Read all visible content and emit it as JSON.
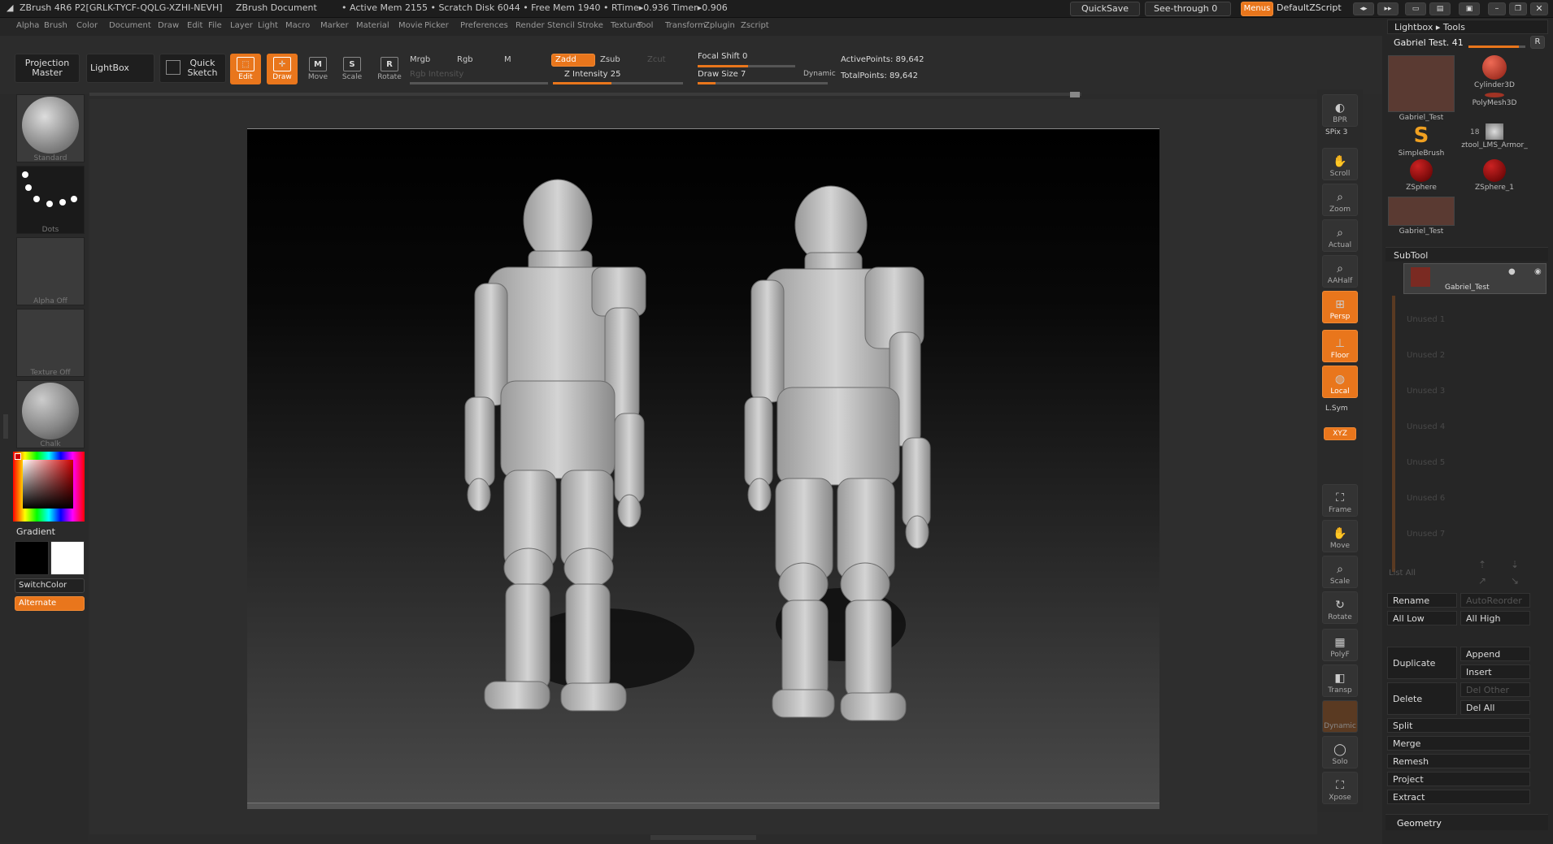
{
  "title": {
    "app": "ZBrush 4R6 P2[GRLK-TYCF-QQLG-XZHI-NEVH]",
    "doc": "ZBrush Document",
    "mem": "• Active Mem 2155 • Scratch Disk 6044 • Free Mem 1940 • RTime▸0.936 Timer▸0.906",
    "quicksave": "QuickSave",
    "seethrough": "See-through  0",
    "menus": "Menus",
    "script": "DefaultZScript"
  },
  "menu": [
    "Alpha",
    "Brush",
    "Color",
    "Document",
    "Draw",
    "Edit",
    "File",
    "Layer",
    "Light",
    "Macro",
    "Marker",
    "Material",
    "Movie",
    "Picker",
    "Preferences",
    "Render",
    "Stencil",
    "Stroke",
    "Texture",
    "Tool",
    "Transform",
    "Zplugin",
    "Zscript"
  ],
  "toolbar": {
    "projection": "Projection Master",
    "lightbox": "LightBox",
    "quicksketch": "Quick Sketch",
    "edit": "Edit",
    "draw": "Draw",
    "move": "Move",
    "scale": "Scale",
    "rotate": "Rotate",
    "mrgb": "Mrgb",
    "rgb": "Rgb",
    "m": "M",
    "zadd": "Zadd",
    "zsub": "Zsub",
    "zcut": "Zcut",
    "rgb_intensity": "Rgb Intensity",
    "z_intensity": "Z Intensity 25",
    "focal": "Focal Shift 0",
    "draw_size": "Draw Size 7",
    "dynamic": "Dynamic",
    "active_points": "ActivePoints: 89,642",
    "total_points": "TotalPoints: 89,642"
  },
  "left": {
    "brush": "Standard",
    "stroke": "Dots",
    "alpha": "Alpha Off",
    "texture": "Texture Off",
    "material": "Chalk",
    "gradient": "Gradient",
    "switchcolor": "SwitchColor",
    "alternate": "Alternate"
  },
  "shelf": [
    "BPR",
    "SPix 3",
    "Scroll",
    "Zoom",
    "Actual",
    "AAHalf",
    "Persp",
    "Floor",
    "Local",
    "L.Sym",
    "XYZ",
    "Frame",
    "Move",
    "Scale",
    "Rotate",
    "PolyF",
    "Transp",
    "Dynamic",
    "Solo",
    "Xpose"
  ],
  "tray": {
    "header": "Lightbox ▸ Tools",
    "tool_name": "Gabriel Test. 41",
    "r": "R",
    "tools": [
      "Gabriel_Test",
      "Cylinder3D",
      "PolyMesh3D",
      "SimpleBrush",
      "ztool_LMS_Armor_",
      "ZSphere",
      "ZSphere_1",
      "Gabriel_Test"
    ],
    "count": "18",
    "subtool": "SubTool",
    "subtool_item": "Gabriel_Test",
    "unused": [
      "Unused 1",
      "Unused 2",
      "Unused 3",
      "Unused 4",
      "Unused 5",
      "Unused 6",
      "Unused 7"
    ],
    "listall": "List  All",
    "rename": "Rename",
    "autoreorder": "AutoReorder",
    "alllow": "All Low",
    "allhigh": "All High",
    "duplicate": "Duplicate",
    "append": "Append",
    "insert": "Insert",
    "delete": "Delete",
    "delother": "Del Other",
    "delall": "Del All",
    "split": "Split",
    "merge": "Merge",
    "remesh": "Remesh",
    "project": "Project",
    "extract": "Extract",
    "geometry": "Geometry"
  },
  "colors": {
    "accent": "#e9761c"
  }
}
